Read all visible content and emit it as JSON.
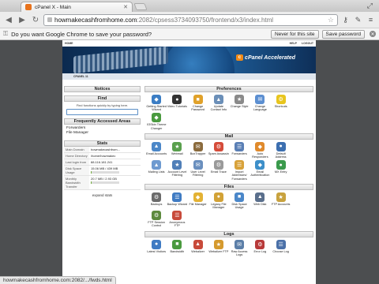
{
  "browser": {
    "tab_title": "cPanel X - Main",
    "url_host": "howmakecashfromhome.com",
    "url_path": ":2082/cpsess3734093750/frontend/x3/index.html",
    "status_url": "howmakecashfromhome.com:2082/.../fwds.html"
  },
  "infobar": {
    "message": "Do you want Google Chrome to save your password?",
    "never_label": "Never for this site",
    "save_label": "Save password"
  },
  "cpanel": {
    "topnav": {
      "home": "HOME",
      "help": "HELP",
      "logout": "LOGOUT"
    },
    "logo_text": "cPanel Accelerated",
    "logo_mark": "c",
    "theme_label": "CPANEL 11",
    "notices_title": "Notices",
    "find": {
      "title": "Find",
      "hint": "Find functions quickly by typing here."
    },
    "frequent": {
      "title": "Frequently Accessed Areas",
      "items": [
        "Forwarders",
        "File Manager"
      ]
    },
    "stats": {
      "title": "Stats",
      "rows": [
        {
          "key": "Main Domain",
          "value": "howmakecashfrom..."
        },
        {
          "key": "Home Directory",
          "value": "/home/howmakec"
        },
        {
          "key": "Last login from",
          "value": "88.116.181.241"
        },
        {
          "key": "Disk Space Usage",
          "value": "15.06 MB / 439 MB"
        },
        {
          "key": "Monthly Bandwidth Transfer",
          "value": "20.7 MB / 2.93 GB"
        }
      ],
      "disk_fraction": 0.034,
      "bandwidth_fraction": 0.007,
      "expand": "expand stats"
    },
    "sections": [
      {
        "title": "Preferences",
        "items": [
          {
            "label": "Getting Started Wizard",
            "icon": "wizard-icon",
            "color": "#3b7dc4"
          },
          {
            "label": "Video Tutorials",
            "icon": "video-icon",
            "color": "#333333"
          },
          {
            "label": "Change Password",
            "icon": "password-icon",
            "color": "#e0a12a"
          },
          {
            "label": "Update Contact Info",
            "icon": "contact-icon",
            "color": "#6b8fb8"
          },
          {
            "label": "Change Style",
            "icon": "style-icon",
            "color": "#8a8a8a"
          },
          {
            "label": "Change Language",
            "icon": "language-icon",
            "color": "#5c8fd1"
          },
          {
            "label": "Shortcuts",
            "icon": "shortcuts-icon",
            "color": "#e8c51e"
          },
          {
            "label": "",
            "icon": "",
            "color": ""
          },
          {
            "label": "X3Skin Theme Changer",
            "icon": "theme-icon",
            "color": "#4a9a3f"
          }
        ]
      },
      {
        "title": "Mail",
        "items": [
          {
            "label": "Email Accounts",
            "icon": "email-icon",
            "color": "#4b87c8"
          },
          {
            "label": "Webmail",
            "icon": "webmail-icon",
            "color": "#5aa04e"
          },
          {
            "label": "BoxTrapper",
            "icon": "boxtrapper-icon",
            "color": "#8b6b3d"
          },
          {
            "label": "Spam Assassin",
            "icon": "spam-icon",
            "color": "#d54c3a"
          },
          {
            "label": "Forwarders",
            "icon": "forwarders-icon",
            "color": "#5a7fb5"
          },
          {
            "label": "Auto Responders",
            "icon": "autoresponder-icon",
            "color": "#e08a2c"
          },
          {
            "label": "Default Address",
            "icon": "default-address-icon",
            "color": "#3c6fb0"
          },
          {
            "label": "",
            "icon": "",
            "color": ""
          },
          {
            "label": "Mailing Lists",
            "icon": "mailing-list-icon",
            "color": "#6e9ad0"
          },
          {
            "label": "Account Level Filtering",
            "icon": "account-filter-icon",
            "color": "#507fb8"
          },
          {
            "label": "User Level Filtering",
            "icon": "user-filter-icon",
            "color": "#6a8fbe"
          },
          {
            "label": "Email Trace",
            "icon": "trace-icon",
            "color": "#9a9a9a"
          },
          {
            "label": "Import Addresses/ Forwarders",
            "icon": "import-icon",
            "color": "#d8a23a"
          },
          {
            "label": "Email Authentication",
            "icon": "auth-icon",
            "color": "#3d8fc9"
          },
          {
            "label": "MX Entry",
            "icon": "mx-icon",
            "color": "#3a9a4c"
          },
          {
            "label": "",
            "icon": "",
            "color": ""
          }
        ]
      },
      {
        "title": "Files",
        "items": [
          {
            "label": "Backups",
            "icon": "backups-icon",
            "color": "#6b6b6b"
          },
          {
            "label": "Backup Wizard",
            "icon": "backup-wizard-icon",
            "color": "#3f7bc3"
          },
          {
            "label": "File Manager",
            "icon": "file-manager-icon",
            "color": "#e3b234"
          },
          {
            "label": "Legacy File Manager",
            "icon": "legacy-fm-icon",
            "color": "#d2a236"
          },
          {
            "label": "Disk Space Usage",
            "icon": "disk-icon",
            "color": "#4a87c9"
          },
          {
            "label": "Web Disk",
            "icon": "webdisk-icon",
            "color": "#5a6f8c"
          },
          {
            "label": "FTP Accounts",
            "icon": "ftp-icon",
            "color": "#c8a23e"
          },
          {
            "label": "",
            "icon": "",
            "color": ""
          },
          {
            "label": "FTP Session Control",
            "icon": "ftp-session-icon",
            "color": "#5d8a3e"
          },
          {
            "label": "Anonymous FTP",
            "icon": "anonymous-ftp-icon",
            "color": "#c84a3a"
          }
        ]
      },
      {
        "title": "Logs",
        "items": [
          {
            "label": "Latest Visitors",
            "icon": "visitors-icon",
            "color": "#3f7bc3"
          },
          {
            "label": "Bandwidth",
            "icon": "bandwidth-icon",
            "color": "#4a9a3f"
          },
          {
            "label": "Webalizer",
            "icon": "webalizer-icon",
            "color": "#c84a3a"
          },
          {
            "label": "Webalizer FTP",
            "icon": "webalizer-ftp-icon",
            "color": "#d59a2e"
          },
          {
            "label": "Raw Access Logs",
            "icon": "raw-logs-icon",
            "color": "#5c7fa8"
          },
          {
            "label": "Error Log",
            "icon": "error-log-icon",
            "color": "#b83a3a"
          },
          {
            "label": "Choose Log",
            "icon": "choose-log-icon",
            "color": "#4a70a8"
          }
        ]
      }
    ]
  }
}
